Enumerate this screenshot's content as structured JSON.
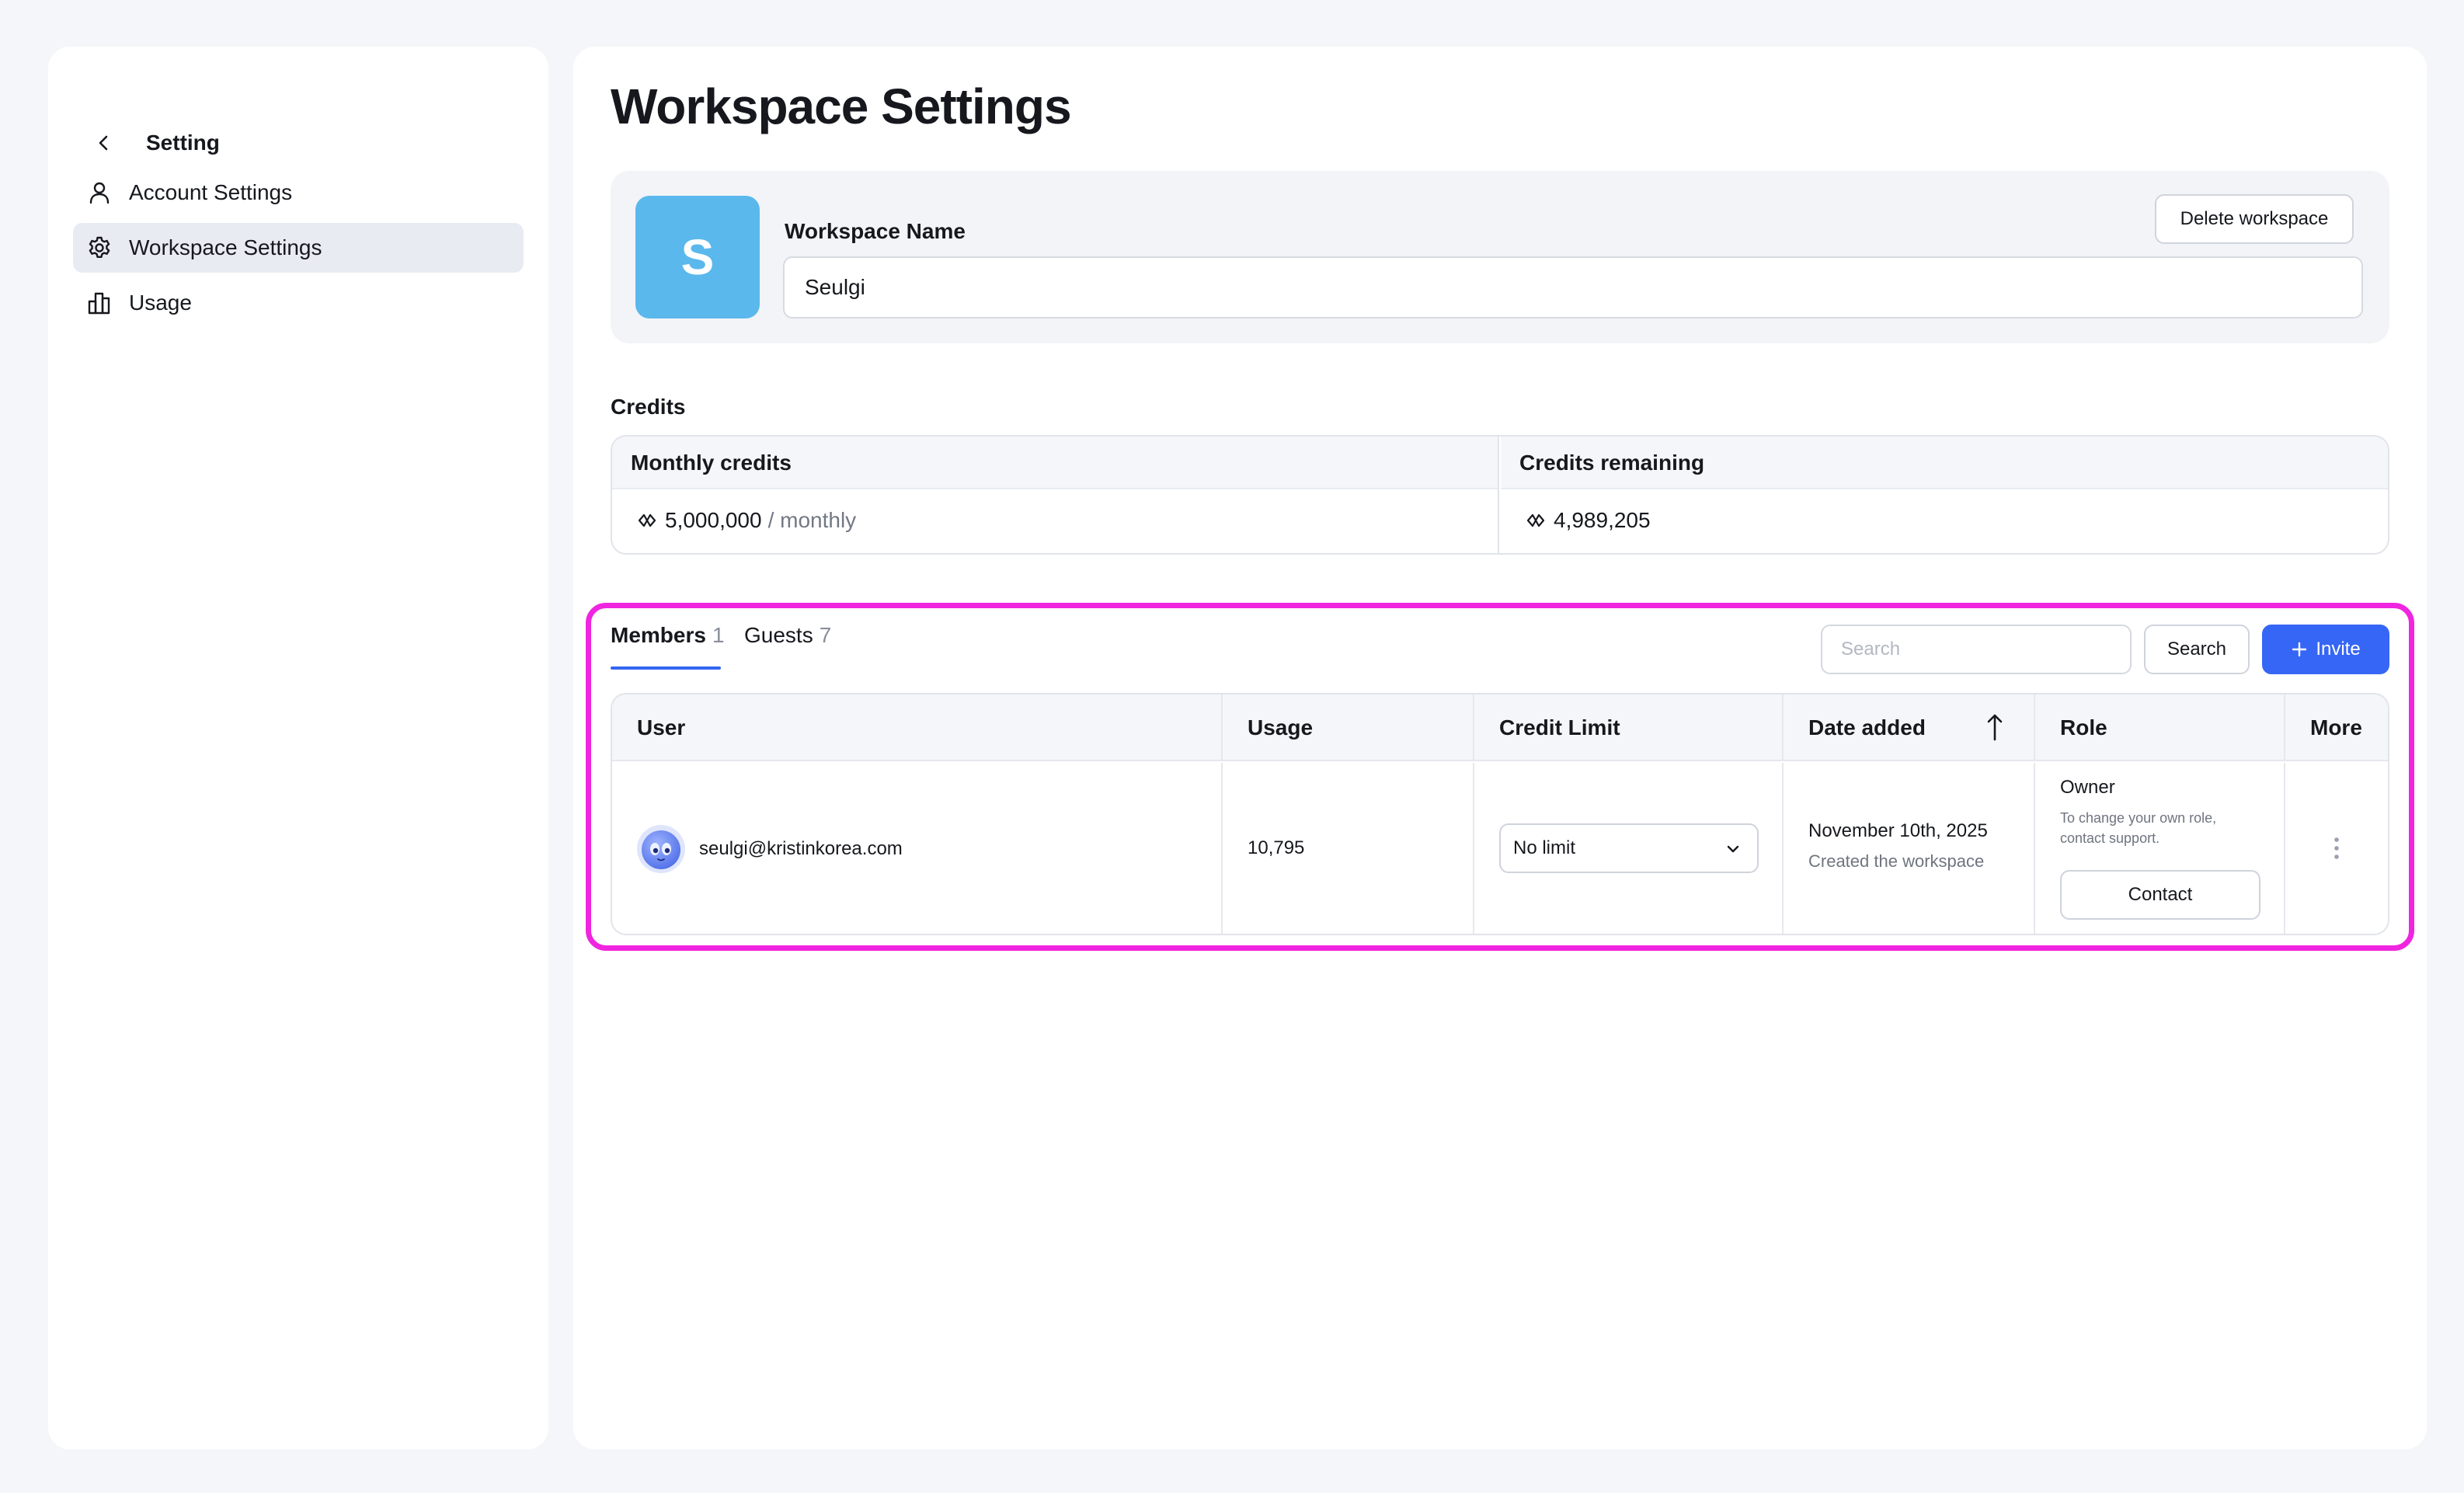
{
  "sidebar": {
    "title": "Setting",
    "back_icon": "chevron-left-icon",
    "items": [
      {
        "label": "Account Settings",
        "icon": "user-icon"
      },
      {
        "label": "Workspace Settings",
        "icon": "gear-icon",
        "active": true
      },
      {
        "label": "Usage",
        "icon": "bar-chart-icon"
      }
    ]
  },
  "main": {
    "title": "Workspace Settings",
    "workspace": {
      "avatar_letter": "S",
      "avatar_color": "#5ab8ec",
      "name_label": "Workspace Name",
      "name_value": "Seulgi",
      "delete_label": "Delete workspace"
    },
    "credits": {
      "title": "Credits",
      "monthly_label": "Monthly credits",
      "monthly_value": "5,000,000",
      "monthly_unit": "/ monthly",
      "remaining_label": "Credits remaining",
      "remaining_value": "4,989,205"
    },
    "tabs": [
      {
        "label": "Members",
        "count": "1",
        "active": true
      },
      {
        "label": "Guests",
        "count": "7"
      }
    ],
    "search": {
      "placeholder": "Search",
      "button_label": "Search"
    },
    "invite_label": "Invite",
    "accent_color": "#3666f5",
    "table": {
      "headers": [
        "User",
        "Usage",
        "Credit Limit",
        "Date added",
        "Role",
        "More"
      ],
      "sort_icon": "arrow-up-icon",
      "rows": [
        {
          "email": "seulgi@kristinkorea.com",
          "usage": "10,795",
          "credit_limit": "No limit",
          "date": "November 10th, 2025",
          "date_note": "Created the workspace",
          "role": "Owner",
          "role_note": "To change your own role, contact support.",
          "contact_label": "Contact"
        }
      ]
    }
  },
  "highlight_color": "#f025e0"
}
